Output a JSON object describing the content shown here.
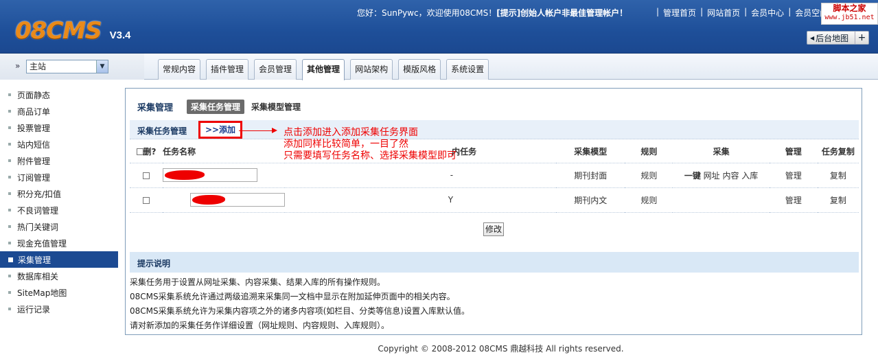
{
  "header": {
    "logo": "08CMS",
    "version": "V3.4",
    "welcome_prefix": "您好：SunPywc，欢迎使用08CMS！",
    "welcome_tip": "[提示]创始人帐户非最佳管理帐户！",
    "links": [
      "管理首页",
      "网站首页",
      "会员中心",
      "会员空间"
    ],
    "watermark_line1": "脚本之家",
    "watermark_line2": "www.jb51.net",
    "sitemap_label": "后台地图",
    "sitemap_plus": "+"
  },
  "site_select": {
    "value": "主站"
  },
  "tabs": [
    {
      "label": "常规内容",
      "active": false
    },
    {
      "label": "插件管理",
      "active": false
    },
    {
      "label": "会员管理",
      "active": false
    },
    {
      "label": "其他管理",
      "active": true
    },
    {
      "label": "网站架构",
      "active": false
    },
    {
      "label": "模版风格",
      "active": false
    },
    {
      "label": "系统设置",
      "active": false
    }
  ],
  "sidebar": {
    "items": [
      {
        "label": "页面静态"
      },
      {
        "label": "商品订单"
      },
      {
        "label": "投票管理"
      },
      {
        "label": "站内短信"
      },
      {
        "label": "附件管理"
      },
      {
        "label": "订阅管理"
      },
      {
        "label": "积分充/扣值"
      },
      {
        "label": "不良词管理"
      },
      {
        "label": "热门关键词"
      },
      {
        "label": "现金充值管理"
      },
      {
        "label": "采集管理",
        "active": true
      },
      {
        "label": "数据库相关"
      },
      {
        "label": "SiteMap地图"
      },
      {
        "label": "运行记录"
      }
    ]
  },
  "panel": {
    "title": "采集管理",
    "subtab_active": "采集任务管理",
    "subtab": "采集模型管理",
    "section_title": "采集任务管理",
    "add_link": ">>添加",
    "columns": [
      "删?",
      "任务名称",
      "内任务",
      "采集模型",
      "规则",
      "采集",
      "管理",
      "任务复制"
    ],
    "rows": [
      {
        "inner": "-",
        "model": "期刊封面",
        "rule": "规则",
        "collect_bold": "一键",
        "collect": "网址 内容 入库",
        "manage": "管理",
        "copy": "复制"
      },
      {
        "inner": "Y",
        "model": "期刊内文",
        "rule": "规则",
        "collect_bold": "",
        "collect": "",
        "manage": "管理",
        "copy": "复制"
      }
    ],
    "modify_button": "修改",
    "hint_title": "提示说明",
    "hints": [
      "采集任务用于设置从网址采集、内容采集、结果入库的所有操作规则。",
      "08CMS采集系统允许通过两级追溯来采集同一文档中显示在附加延伸页面中的相关内容。",
      "08CMS采集系统允许为采集内容项之外的诸多内容项(如栏目、分类等信息)设置入库默认值。",
      "请对新添加的采集任务作详细设置（网址规则、内容规则、入库规则）。"
    ]
  },
  "annotation": {
    "lines": [
      "点击添加进入添加采集任务界面",
      "添加同样比较简单，一目了然",
      "只需要填写任务名称、选择采集模型即可"
    ]
  },
  "footer": "Copyright © 2008-2012 08CMS 鼎越科技 All rights reserved."
}
